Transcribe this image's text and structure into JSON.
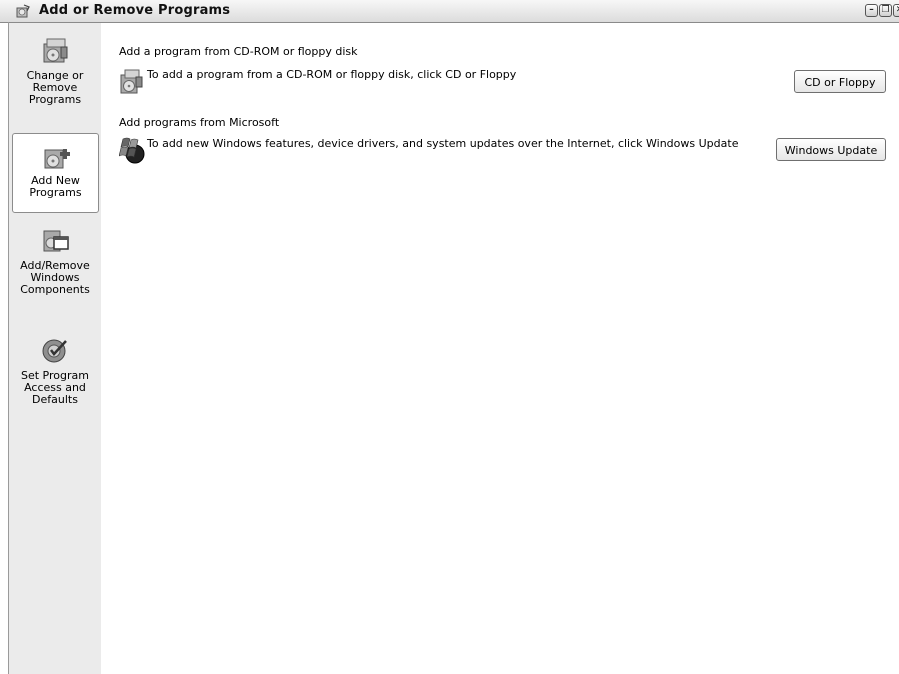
{
  "window": {
    "title": "Add or Remove Programs",
    "controls": [
      "minimize",
      "restore",
      "close"
    ]
  },
  "sidebar": {
    "items": [
      {
        "id": "change-remove",
        "label": "Change or\nRemove\nPrograms",
        "icon": "programs-box-icon",
        "selected": false
      },
      {
        "id": "add-new",
        "label": "Add New\nPrograms",
        "icon": "add-programs-icon",
        "selected": true
      },
      {
        "id": "windows-components",
        "label": "Add/Remove\nWindows\nComponents",
        "icon": "windows-components-icon",
        "selected": false
      },
      {
        "id": "set-defaults",
        "label": "Set Program\nAccess and\nDefaults",
        "icon": "program-defaults-icon",
        "selected": false
      }
    ]
  },
  "content": {
    "sections": [
      {
        "title": "Add a program from CD-ROM or floppy disk",
        "description": "To add a program from a CD-ROM or floppy disk, click CD or Floppy",
        "button": "CD or Floppy",
        "icon": "cd-install-icon"
      },
      {
        "title": "Add programs from Microsoft",
        "description": "To add new Windows features, device drivers, and system updates over the Internet, click Windows Update",
        "button": "Windows Update",
        "icon": "windows-update-icon"
      }
    ]
  },
  "colors": {
    "sidebar_bg": "#ebebeb",
    "content_bg": "#ffffff",
    "titlebar": "#dcdcdc"
  }
}
